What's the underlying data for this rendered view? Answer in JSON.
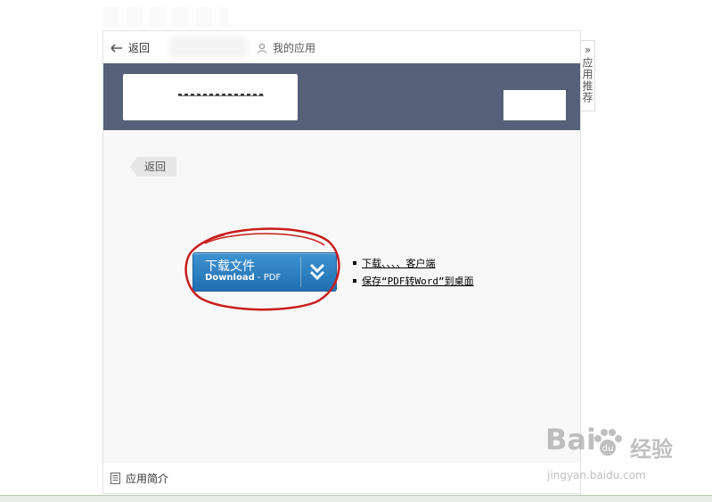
{
  "topbar": {
    "back_label": "返回",
    "my_apps_label": "我的应用"
  },
  "content": {
    "back_tag_label": "返回",
    "download_button": {
      "title": "下载文件",
      "subtitle_bold": "Download",
      "subtitle_rest": " - PDF"
    },
    "links": [
      {
        "label": "下载、、、、客户端"
      },
      {
        "label": "保存“PDF转Word”到桌面"
      }
    ]
  },
  "footer": {
    "label": "应用简介"
  },
  "side_tab": {
    "arrows": "»",
    "label": "应用推荐"
  },
  "watermark": {
    "brand": "Bai",
    "brand_suffix": "du",
    "cn_text": "经验",
    "url": "jingyan.baidu.com"
  },
  "colors": {
    "banner": "#566078",
    "button_top": "#3f93d0",
    "button_bottom": "#1f6fb1",
    "annotation_red": "#c81d1d"
  },
  "icons": [
    "back-arrow-icon",
    "user-icon",
    "double-chevron-down-icon",
    "document-icon",
    "double-chevron-right-icon",
    "baidu-paw-icon"
  ]
}
